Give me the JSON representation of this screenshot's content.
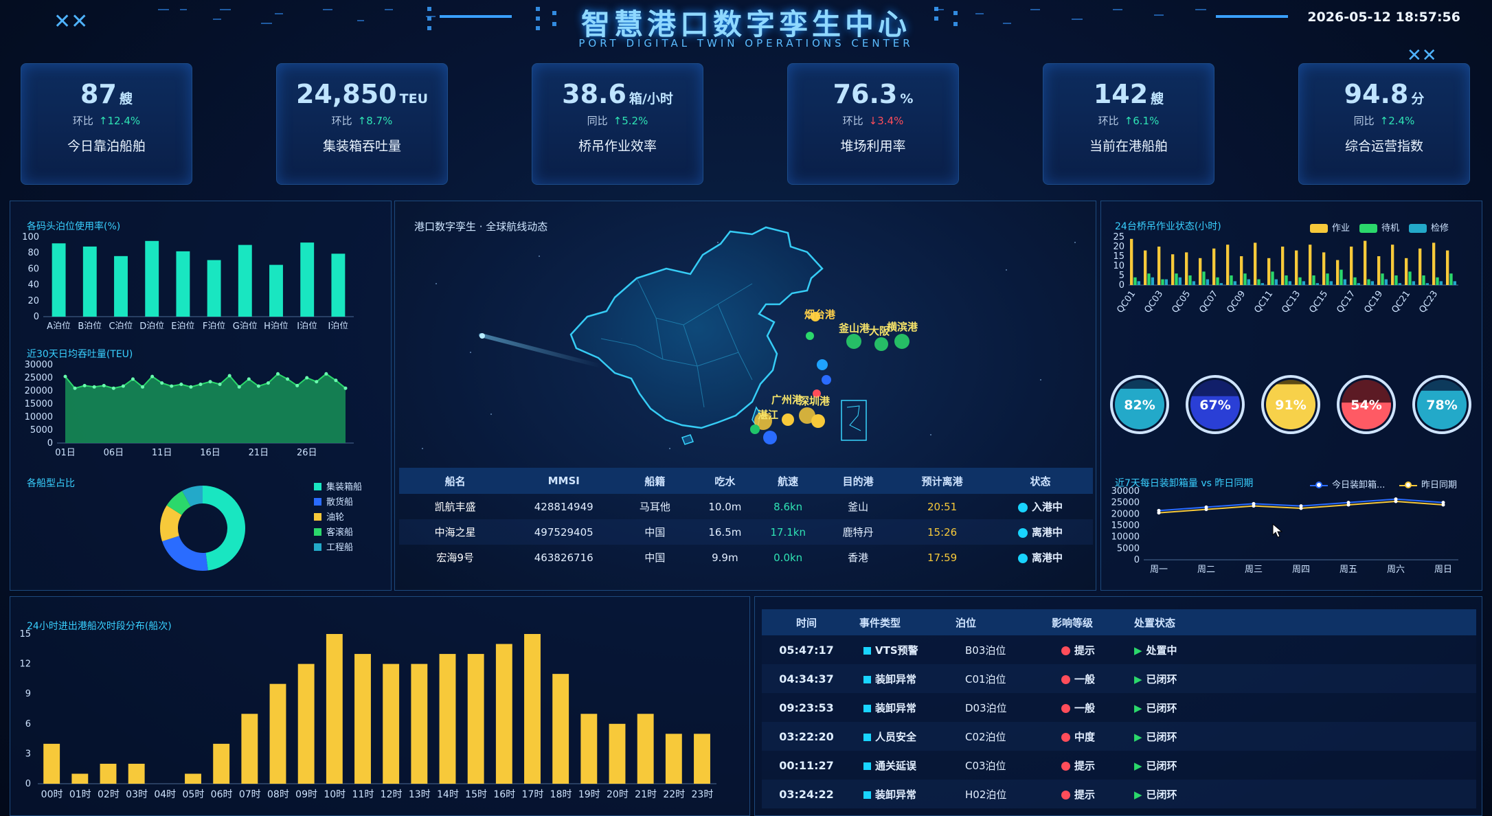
{
  "header": {
    "title": "智慧港口数字孪生中心",
    "subtitle": "PORT DIGITAL TWIN OPERATIONS CENTER",
    "datetime": "2026-05-12 18:57:56"
  },
  "kpis": [
    {
      "value": "87",
      "unit": "艘",
      "change_label": "环比",
      "change": "12.4%",
      "direction": "up",
      "label": "今日靠泊船舶"
    },
    {
      "value": "24,850",
      "unit": "TEU",
      "change_label": "环比",
      "change": "8.7%",
      "direction": "up",
      "label": "集装箱吞吐量"
    },
    {
      "value": "38.6",
      "unit": "箱/小时",
      "change_label": "同比",
      "change": "5.2%",
      "direction": "up",
      "label": "桥吊作业效率"
    },
    {
      "value": "76.3",
      "unit": "%",
      "change_label": "环比",
      "change": "3.4%",
      "direction": "down",
      "label": "堆场利用率"
    },
    {
      "value": "142",
      "unit": "艘",
      "change_label": "环比",
      "change": "6.1%",
      "direction": "up",
      "label": "当前在港船舶"
    },
    {
      "value": "94.8",
      "unit": "分",
      "change_label": "同比",
      "change": "2.4%",
      "direction": "up",
      "label": "综合运营指数"
    }
  ],
  "colors": {
    "cyan": "#19e6c1",
    "green": "#1fc46a",
    "yellow": "#f7c93a",
    "blue": "#2a6cff",
    "teal": "#23a9c9",
    "red": "#ff4d5a"
  },
  "chart_data": [
    {
      "id": "berth",
      "type": "bar",
      "title": "各码头泊位使用率(%)",
      "categories": [
        "A泊位",
        "B泊位",
        "C泊位",
        "D泊位",
        "E泊位",
        "F泊位",
        "G泊位",
        "H泊位",
        "I泊位",
        "J泊位"
      ],
      "values": [
        92,
        88,
        76,
        95,
        82,
        71,
        90,
        65,
        93,
        79
      ],
      "ylim": [
        0,
        100
      ],
      "yticks": [
        0,
        20,
        40,
        60,
        80,
        100
      ]
    },
    {
      "id": "teu30",
      "type": "area",
      "title": "近30天日均吞吐量(TEU)",
      "x": [
        1,
        2,
        3,
        4,
        5,
        6,
        7,
        8,
        9,
        10,
        11,
        12,
        13,
        14,
        15,
        16,
        17,
        18,
        19,
        20,
        21,
        22,
        23,
        24,
        25,
        26,
        27,
        28,
        29,
        30
      ],
      "values": [
        25500,
        21000,
        22000,
        21500,
        22000,
        21000,
        21800,
        24500,
        21500,
        25500,
        23000,
        21800,
        22500,
        21500,
        22500,
        23500,
        22500,
        25800,
        21500,
        24500,
        21800,
        23000,
        26500,
        24500,
        22000,
        25000,
        23500,
        26500,
        24000,
        21000
      ],
      "ylim": [
        0,
        30000
      ],
      "yticks": [
        0,
        5000,
        10000,
        15000,
        20000,
        25000,
        30000
      ],
      "xticks": [
        "01日",
        "06日",
        "11日",
        "16日",
        "21日",
        "26日"
      ]
    },
    {
      "id": "shiptype",
      "type": "pie",
      "title": "各船型占比",
      "legend": [
        "集装箱船",
        "散货船",
        "油轮",
        "客滚船",
        "工程船"
      ],
      "values": [
        48,
        22,
        14,
        8,
        8
      ]
    },
    {
      "id": "crane",
      "type": "bar",
      "title": "24台桥吊作业状态(小时)",
      "legend": [
        "作业",
        "待机",
        "检修"
      ],
      "categories": [
        "QC01",
        "QC02",
        "QC03",
        "QC04",
        "QC05",
        "QC06",
        "QC07",
        "QC08",
        "QC09",
        "QC10",
        "QC11",
        "QC12",
        "QC13",
        "QC14",
        "QC15",
        "QC16",
        "QC17",
        "QC18",
        "QC19",
        "QC20",
        "QC21",
        "QC22",
        "QC23",
        "QC24"
      ],
      "xticks": [
        "QC01",
        "QC03",
        "QC05",
        "QC07",
        "QC09",
        "QC11",
        "QC13",
        "QC15",
        "QC17",
        "QC19",
        "QC21",
        "QC23"
      ],
      "series": [
        {
          "name": "作业",
          "values": [
            24,
            18,
            20,
            16,
            17,
            14,
            19,
            21,
            15,
            22,
            14,
            20,
            18,
            21,
            17,
            13,
            20,
            23,
            15,
            21,
            14,
            19,
            22,
            18
          ]
        },
        {
          "name": "待机",
          "values": [
            4,
            6,
            3,
            6,
            5,
            7,
            4,
            5,
            6,
            3,
            7,
            5,
            4,
            5,
            6,
            8,
            4,
            3,
            6,
            5,
            7,
            5,
            4,
            6
          ]
        },
        {
          "name": "检修",
          "values": [
            2,
            4,
            3,
            4,
            2,
            3,
            1,
            2,
            3,
            1,
            3,
            2,
            2,
            1,
            2,
            3,
            1,
            2,
            3,
            1,
            2,
            1,
            2,
            2
          ]
        }
      ],
      "ylim": [
        0,
        25
      ],
      "yticks": [
        0,
        5,
        10,
        15,
        20,
        25
      ]
    },
    {
      "id": "gauges",
      "type": "gauge",
      "values": [
        82,
        67,
        91,
        54,
        78
      ],
      "labels": [
        "82%",
        "67%",
        "91%",
        "54%",
        "78%"
      ]
    },
    {
      "id": "week",
      "type": "line",
      "title": "近7天每日装卸箱量 vs 昨日同期",
      "legend": [
        "今日装卸箱...",
        "昨日同期"
      ],
      "categories": [
        "周一",
        "周二",
        "周三",
        "周四",
        "周五",
        "周六",
        "周日"
      ],
      "series": [
        {
          "name": "今日装卸箱...",
          "values": [
            21500,
            23000,
            24500,
            23500,
            25000,
            26500,
            25000
          ]
        },
        {
          "name": "昨日同期",
          "values": [
            20500,
            22000,
            23500,
            22500,
            24000,
            25500,
            24000
          ]
        }
      ],
      "ylim": [
        0,
        30000
      ],
      "yticks": [
        0,
        5000,
        10000,
        15000,
        20000,
        25000,
        30000
      ]
    },
    {
      "id": "hourly",
      "type": "bar",
      "title": "24小时进出港船次时段分布(船次)",
      "categories": [
        "00时",
        "01时",
        "02时",
        "03时",
        "04时",
        "05时",
        "06时",
        "07时",
        "08时",
        "09时",
        "10时",
        "11时",
        "12时",
        "13时",
        "14时",
        "15时",
        "16时",
        "17时",
        "18时",
        "19时",
        "20时",
        "21时",
        "22时",
        "23时"
      ],
      "values": [
        4,
        1,
        2,
        2,
        0,
        1,
        4,
        7,
        10,
        12,
        15,
        13,
        12,
        12,
        13,
        13,
        14,
        15,
        11,
        7,
        6,
        7,
        5,
        5
      ],
      "ylim": [
        0,
        15
      ],
      "yticks": [
        0,
        3,
        6,
        9,
        12,
        15
      ]
    }
  ],
  "map": {
    "title": "港口数字孪生 · 全球航线动态",
    "ports": [
      {
        "name": "釜山港"
      },
      {
        "name": "大阪"
      },
      {
        "name": "横滨港"
      },
      {
        "name": "烟台港"
      },
      {
        "name": "湛江"
      },
      {
        "name": "广州港"
      },
      {
        "name": "深圳港"
      }
    ]
  },
  "vessels": {
    "headers": [
      "船名",
      "MMSI",
      "船籍",
      "吃水",
      "航速",
      "目的港",
      "预计离港",
      "状态"
    ],
    "rows": [
      {
        "name": "凯航丰盛",
        "mmsi": "428814949",
        "flag": "马耳他",
        "draft": "10.0m",
        "speed": "8.6kn",
        "dest": "釜山",
        "eta": "20:51",
        "status": "入港中"
      },
      {
        "name": "中海之星",
        "mmsi": "497529405",
        "flag": "中国",
        "draft": "16.5m",
        "speed": "17.1kn",
        "dest": "鹿特丹",
        "eta": "15:26",
        "status": "离港中"
      },
      {
        "name": "宏海9号",
        "mmsi": "463826716",
        "flag": "中国",
        "draft": "9.9m",
        "speed": "0.0kn",
        "dest": "香港",
        "eta": "17:59",
        "status": "离港中"
      }
    ]
  },
  "events": {
    "headers": [
      "时间",
      "事件类型",
      "泊位",
      "影响等级",
      "处置状态"
    ],
    "rows": [
      {
        "time": "05:47:17",
        "type": "VTS预警",
        "berth": "B03泊位",
        "level": "提示",
        "status": "处置中"
      },
      {
        "time": "04:34:37",
        "type": "装卸异常",
        "berth": "C01泊位",
        "level": "一般",
        "status": "已闭环"
      },
      {
        "time": "09:23:53",
        "type": "装卸异常",
        "berth": "D03泊位",
        "level": "一般",
        "status": "已闭环"
      },
      {
        "time": "03:22:20",
        "type": "人员安全",
        "berth": "C02泊位",
        "level": "中度",
        "status": "已闭环"
      },
      {
        "time": "00:11:27",
        "type": "通关延误",
        "berth": "C03泊位",
        "level": "提示",
        "status": "已闭环"
      },
      {
        "time": "03:24:22",
        "type": "装卸异常",
        "berth": "H02泊位",
        "level": "提示",
        "status": "已闭环"
      }
    ]
  }
}
